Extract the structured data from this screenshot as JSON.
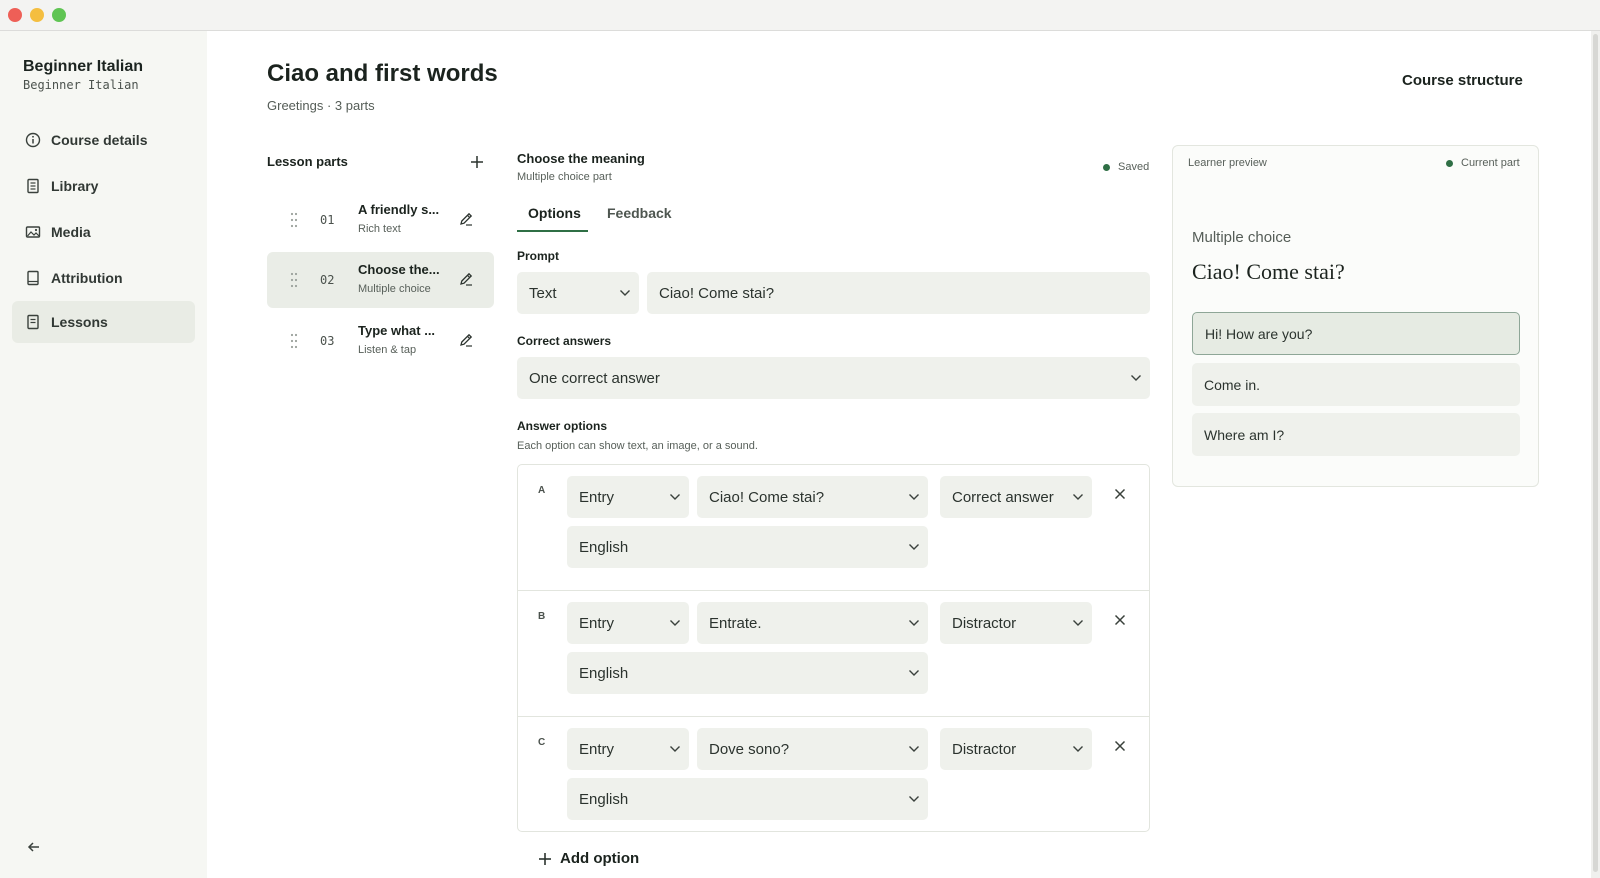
{
  "window": {
    "controls": [
      "close",
      "minimize",
      "zoom"
    ]
  },
  "sidebar": {
    "title": "Beginner Italian",
    "subtitle": "Beginner Italian",
    "items": [
      {
        "label": "Course details",
        "icon": "info-icon"
      },
      {
        "label": "Library",
        "icon": "book-icon"
      },
      {
        "label": "Media",
        "icon": "image-icon"
      },
      {
        "label": "Attribution",
        "icon": "notebook-icon"
      },
      {
        "label": "Lessons",
        "icon": "document-icon",
        "active": true
      }
    ]
  },
  "header": {
    "title": "Ciao and first words",
    "subtitle": "Greetings · 3 parts",
    "course_structure": "Course structure"
  },
  "lesson_parts": {
    "heading": "Lesson parts",
    "items": [
      {
        "num": "01",
        "title": "A friendly s...",
        "type": "Rich text"
      },
      {
        "num": "02",
        "title": "Choose the...",
        "type": "Multiple choice",
        "active": true
      },
      {
        "num": "03",
        "title": "Type what ...",
        "type": "Listen & tap"
      }
    ]
  },
  "editor": {
    "title": "Choose the meaning",
    "subtitle": "Multiple choice part",
    "status": "Saved",
    "tabs": [
      "Options",
      "Feedback"
    ],
    "active_tab": "Options",
    "prompt": {
      "label": "Prompt",
      "type": "Text",
      "value": "Ciao! Come stai?"
    },
    "correct_answers": {
      "label": "Correct answers",
      "value": "One correct answer"
    },
    "answer_options": {
      "label": "Answer options",
      "hint": "Each option can show text, an image, or a sound.",
      "items": [
        {
          "letter": "A",
          "source": "Entry",
          "entry": "Ciao! Come stai?",
          "role": "Correct answer",
          "language": "English"
        },
        {
          "letter": "B",
          "source": "Entry",
          "entry": "Entrate.",
          "role": "Distractor",
          "language": "English"
        },
        {
          "letter": "C",
          "source": "Entry",
          "entry": "Dove sono?",
          "role": "Distractor",
          "language": "English"
        }
      ]
    },
    "add_option": "Add option"
  },
  "preview": {
    "heading": "Learner preview",
    "current": "Current part",
    "kind": "Multiple choice",
    "question": "Ciao! Come stai?",
    "choices": [
      "Hi! How are you?",
      "Come in.",
      "Where am I?"
    ],
    "selected_index": 0
  },
  "colors": {
    "accent": "#2f6f45",
    "sidebar_bg": "#f6f7f3",
    "field_bg": "#eff1ec"
  }
}
